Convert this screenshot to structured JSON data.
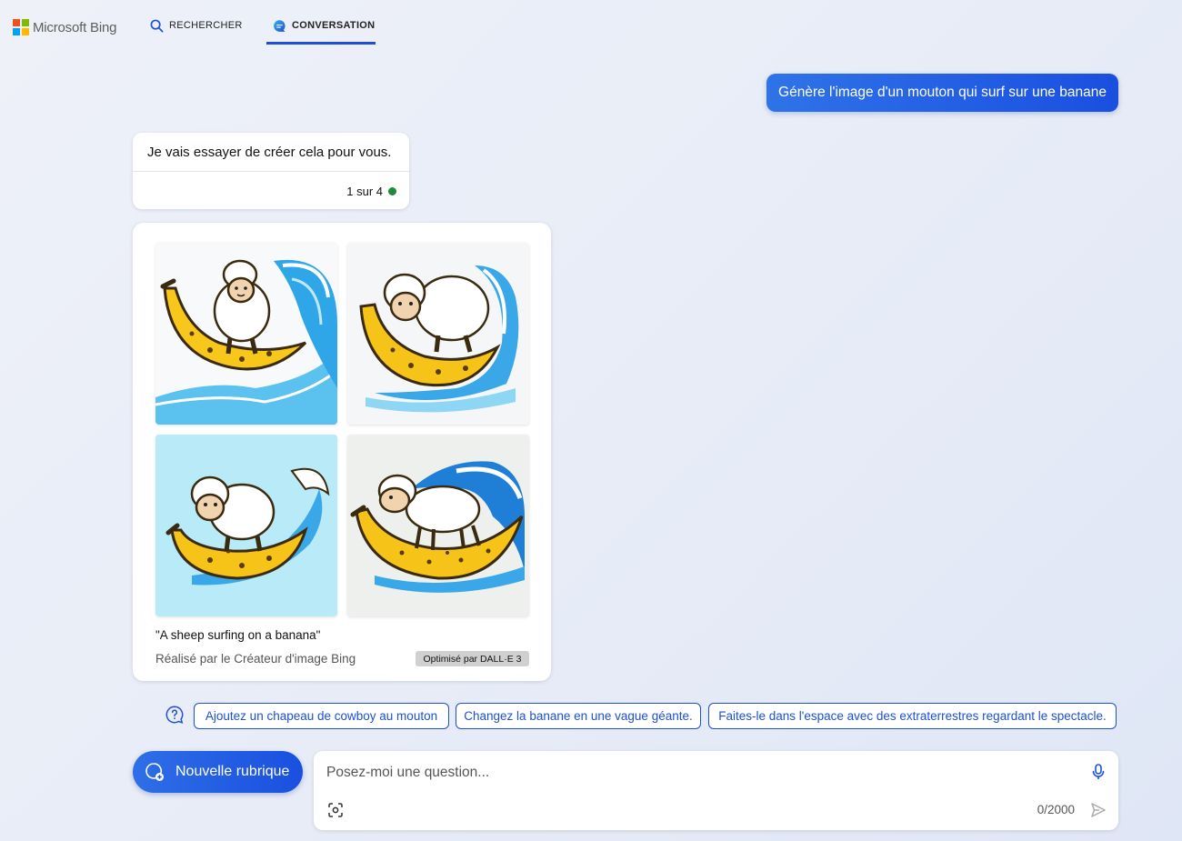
{
  "header": {
    "logo_text": "Microsoft Bing",
    "tabs": [
      {
        "label": "RECHERCHER",
        "icon": "search-icon",
        "active": false
      },
      {
        "label": "CONVERSATION",
        "icon": "chat-bubble-icon",
        "active": true
      }
    ],
    "accent_color": "#1d4fd8"
  },
  "conversation": {
    "user_message": "Génère l'image d'un mouton qui surf sur une banane",
    "bot_message": "Je vais essayer de créer cela pour vous.",
    "turn_counter": "1 sur 4",
    "status_color": "#1e8a3c"
  },
  "image_result": {
    "images": [
      {
        "subject": "sheep surfing on banana over wave"
      },
      {
        "subject": "sheep on banana with wave"
      },
      {
        "subject": "sheep on banana, light blue background"
      },
      {
        "subject": "sheep on banana in front of curling wave"
      }
    ],
    "caption": "\"A sheep surfing on a banana\"",
    "credit": "Réalisé par le Créateur d'image Bing",
    "badge": "Optimisé par DALL·E 3"
  },
  "suggestions": [
    "Ajoutez un chapeau de cowboy au mouton",
    "Changez la banane en une vague géante.",
    "Faites-le dans l'espace avec des extraterrestres regardant le spectacle."
  ],
  "new_topic_label": "Nouvelle rubrique",
  "input": {
    "placeholder": "Posez-moi une question...",
    "value": "",
    "char_count": "0/2000"
  }
}
